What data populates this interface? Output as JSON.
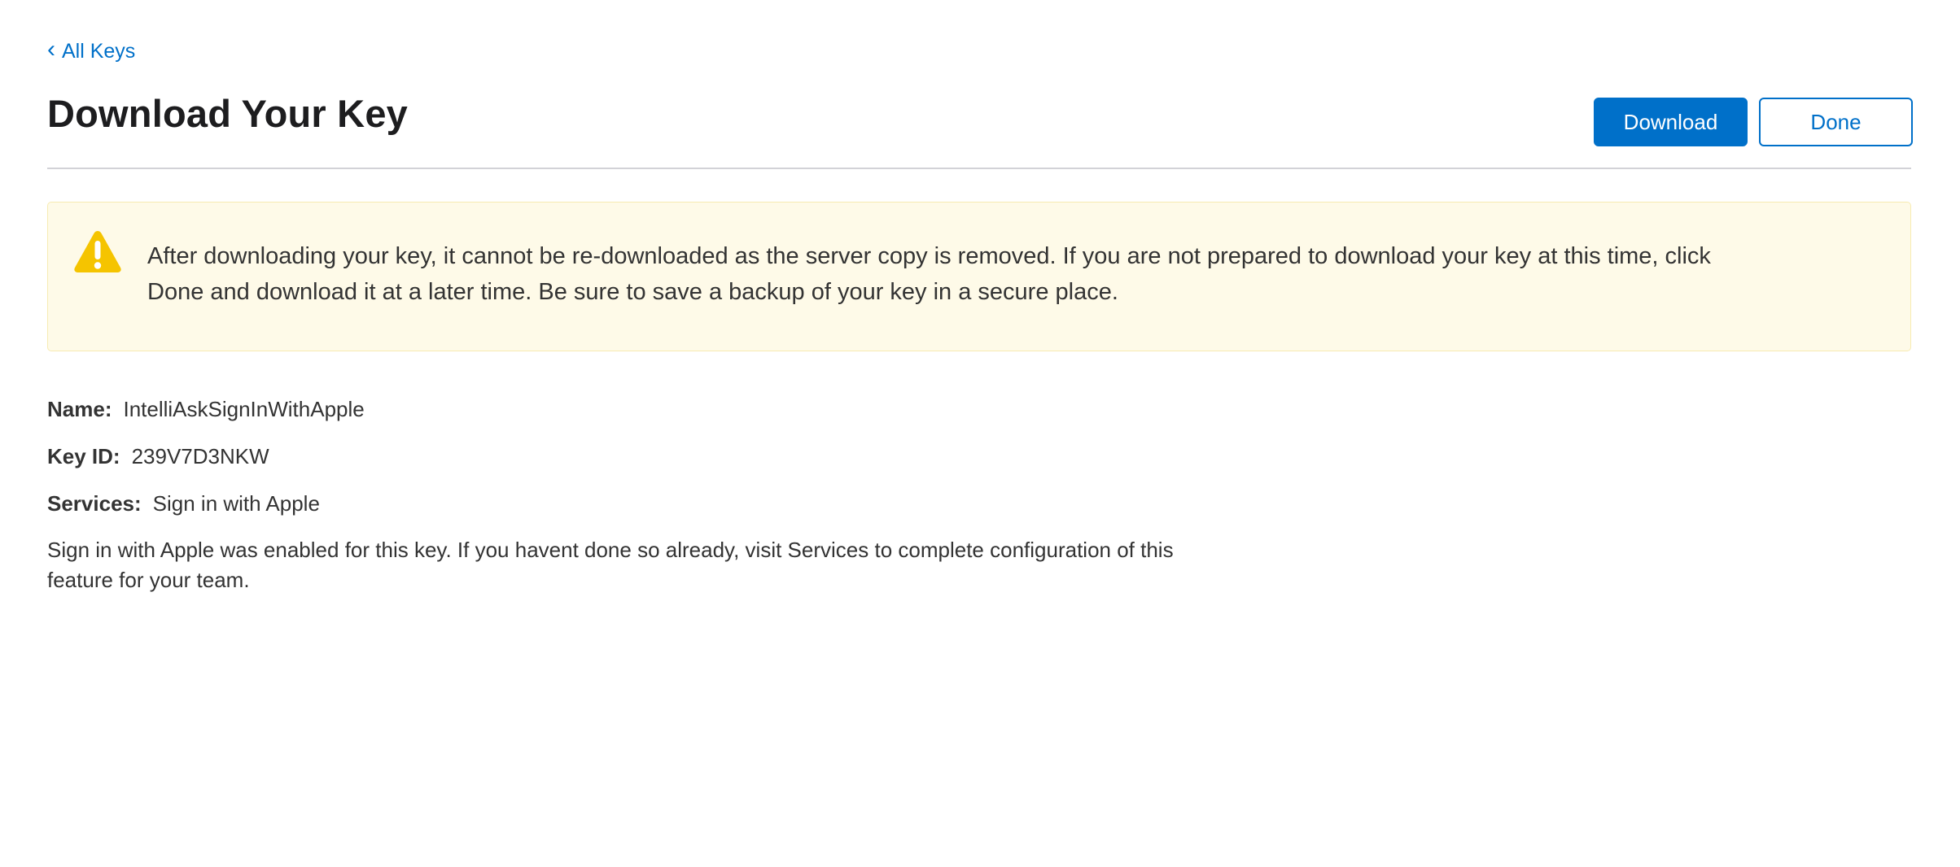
{
  "nav": {
    "back_label": "All Keys"
  },
  "header": {
    "title": "Download Your Key",
    "download_label": "Download",
    "done_label": "Done"
  },
  "warning": {
    "icon": "warning-triangle-icon",
    "text": "After downloading your key, it cannot be re-downloaded as the server copy is removed. If you are not prepared to download your key at this time, click Done and download it at a later time. Be sure to save a backup of your key in a secure place."
  },
  "details": {
    "name_label": "Name:",
    "name_value": "IntelliAskSignInWithApple",
    "key_id_label": "Key ID:",
    "key_id_value": "239V7D3NKW",
    "services_label": "Services:",
    "services_value": "Sign in with Apple",
    "info": "Sign in with Apple was enabled for this key. If you havent done so already, visit Services to complete configuration of this feature for your team."
  },
  "colors": {
    "accent": "#0070c9",
    "warning_bg": "#fefae8",
    "warning_icon": "#f5c400"
  }
}
